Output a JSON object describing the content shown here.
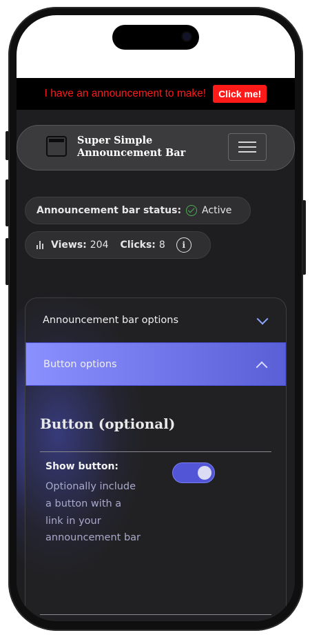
{
  "announcement": {
    "text": "I have an announcement to make!",
    "button_label": "Click me!",
    "color": "#ff1a1a"
  },
  "header": {
    "logo_icon": "window-icon",
    "title_line1": "Super Simple",
    "title_line2": "Announcement Bar",
    "menu_icon": "hamburger-menu-icon"
  },
  "status": {
    "label": "Announcement bar status:",
    "value": "Active",
    "icon": "check-circle-icon",
    "color": "#4caf50"
  },
  "stats": {
    "icon": "bar-chart-icon",
    "views_label": "Views:",
    "views_value": "204",
    "clicks_label": "Clicks:",
    "clicks_value": "8",
    "info_icon": "info-icon",
    "info_glyph": "i"
  },
  "accordion": {
    "items": [
      {
        "label": "Announcement bar options",
        "expanded": false
      },
      {
        "label": "Button options",
        "expanded": true
      }
    ],
    "accent": "#8b90ff"
  },
  "button_section": {
    "title": "Button (optional)",
    "show_button": {
      "label": "Show button:",
      "description": "Optionally include a button with a link in your announcement bar",
      "enabled": true
    }
  }
}
